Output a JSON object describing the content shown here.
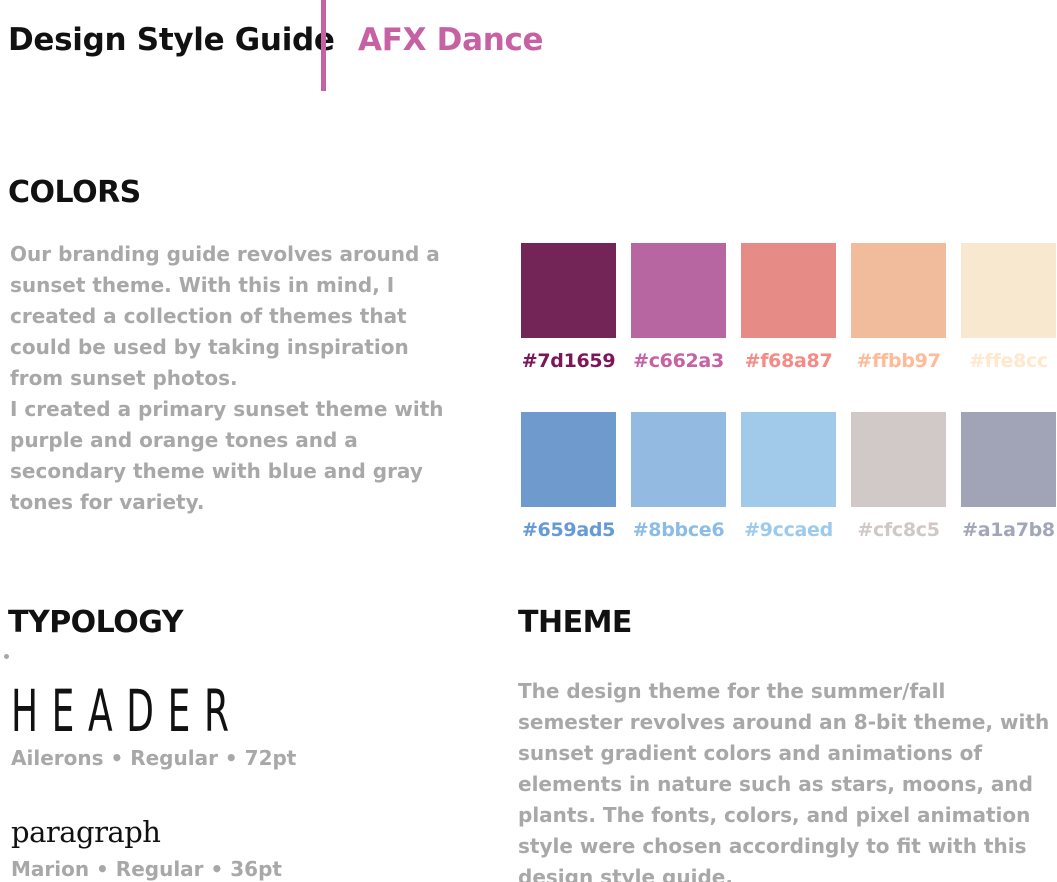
{
  "header": {
    "title": "Design Style Guide",
    "subtitle": "AFX Dance"
  },
  "colors": {
    "heading": "COLORS",
    "paragraphs": [
      "Our branding guide revolves around a sunset theme. With this in mind, I created a collection of themes that could be used by taking inspiration from sunset photos.",
      "I created a primary sunset theme with purple and orange tones and a secondary theme with blue and gray tones for variety."
    ],
    "primary": [
      {
        "hex": "#7d1659",
        "swatch": "#732557",
        "label_color": "#7d1659"
      },
      {
        "hex": "#c662a3",
        "swatch": "#b766a2",
        "label_color": "#c662a3"
      },
      {
        "hex": "#f68a87",
        "swatch": "#e68b86",
        "label_color": "#f68a87"
      },
      {
        "hex": "#ffbb97",
        "swatch": "#f0bc9b",
        "label_color": "#ffbb97"
      },
      {
        "hex": "#ffe8cc",
        "swatch": "#f9e8d0",
        "label_color": "#ffe8cc"
      }
    ],
    "secondary": [
      {
        "hex": "#659ad5",
        "swatch": "#6f9ace",
        "label_color": "#659ad5"
      },
      {
        "hex": "#8bbce6",
        "swatch": "#93bbe1",
        "label_color": "#8bbce6"
      },
      {
        "hex": "#9ccaed",
        "swatch": "#a1c9ea",
        "label_color": "#9ccaed"
      },
      {
        "hex": "#cfc8c5",
        "swatch": "#d1c9c8",
        "label_color": "#cfc8c5"
      },
      {
        "hex": "#a1a7b8",
        "swatch": "#a1a4b7",
        "label_color": "#a1a7b8"
      }
    ]
  },
  "typology": {
    "heading": "TYPOLOGY",
    "header_sample": "HEADER",
    "header_spec": "Ailerons • Regular • 72pt",
    "paragraph_sample": "paragraph",
    "paragraph_spec": "Marion • Regular • 36pt"
  },
  "theme": {
    "heading": "THEME",
    "text": "The design theme for the summer/fall semester revolves around an 8-bit theme, with sunset gradient colors and animations of elements in nature such as stars, moons, and plants. The fonts, colors, and pixel animation style were chosen accordingly to fit with this design style guide."
  }
}
